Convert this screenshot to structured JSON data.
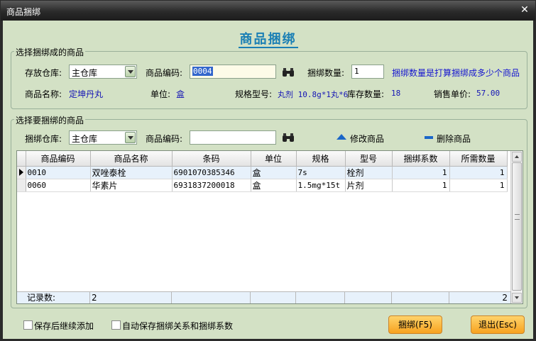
{
  "window": {
    "title": "商品捆绑",
    "close_glyph": "✕"
  },
  "heading": "商品捆绑",
  "bundle_section": {
    "legend": "选择捆绑成的商品",
    "warehouse_label": "存放仓库:",
    "warehouse_value": "主仓库",
    "code_label": "商品编码:",
    "code_value": "0004",
    "qty_label": "捆绑数量:",
    "qty_value": "1",
    "qty_hint": "捆绑数量是打算捆绑成多少个商品",
    "name_label": "商品名称:",
    "name_value": "定坤丹丸",
    "unit_label": "单位:",
    "unit_value": "盒",
    "spec_label": "规格型号:",
    "spec_value": "丸剂 10.8g*1丸*6",
    "stock_label": "库存数量:",
    "stock_value": "18",
    "price_label": "销售单价:",
    "price_value": "57.00"
  },
  "component_section": {
    "legend": "选择要捆绑的商品",
    "warehouse_label": "捆绑仓库:",
    "warehouse_value": "主仓库",
    "code_label": "商品编码:",
    "code_value": "",
    "modify_label": "修改商品",
    "delete_label": "删除商品"
  },
  "grid": {
    "columns": [
      "商品编码",
      "商品名称",
      "条码",
      "单位",
      "规格",
      "型号",
      "捆绑系数",
      "所需数量"
    ],
    "rows": [
      {
        "code": "0010",
        "name": "双唑泰栓",
        "barcode": "6901070385346",
        "unit": "盒",
        "spec": "7s",
        "model": "栓剂",
        "factor": "1",
        "need": "1"
      },
      {
        "code": "0060",
        "name": "华素片",
        "barcode": "6931837200018",
        "unit": "盒",
        "spec": "1.5mg*15t",
        "model": "片剂",
        "factor": "1",
        "need": "1"
      }
    ],
    "footer_label": "记录数:",
    "footer_count": "2",
    "footer_total": "2"
  },
  "options": {
    "keep_adding": "保存后继续添加",
    "auto_save": "自动保存捆绑关系和捆绑系数"
  },
  "buttons": {
    "bundle": "捆绑(F5)",
    "exit": "退出(Esc)"
  },
  "colors": {
    "background": "#d3e1c5",
    "accent": "#1a7fb5",
    "value_text": "#1515b5",
    "button": "#f7a21f"
  }
}
